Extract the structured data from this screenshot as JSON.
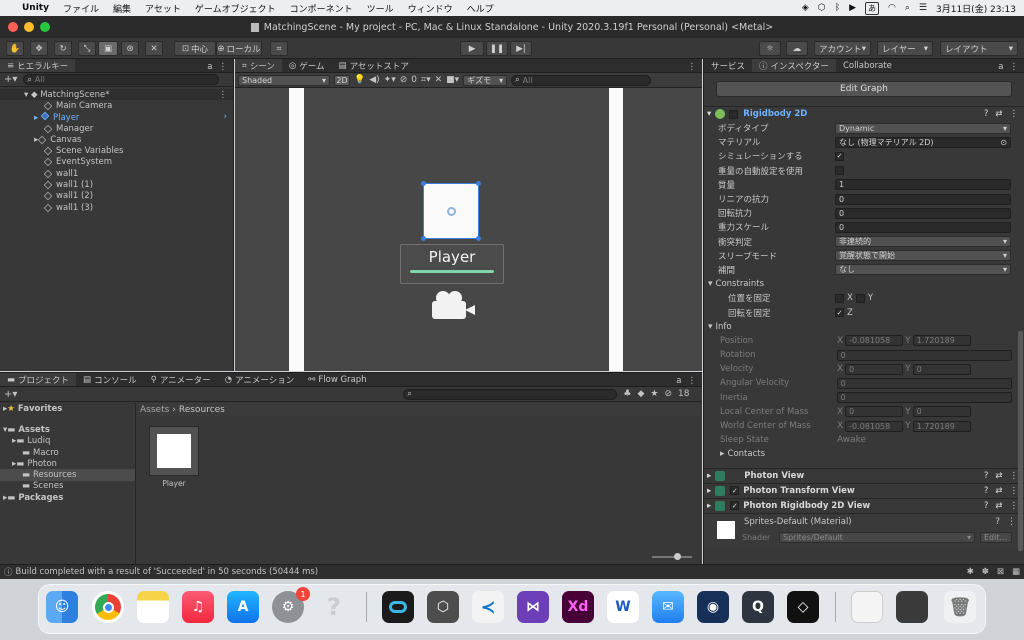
{
  "menubar": {
    "app": "Unity",
    "items": [
      "ファイル",
      "編集",
      "アセット",
      "ゲームオブジェクト",
      "コンポーネント",
      "ツール",
      "ウィンドウ",
      "ヘルプ"
    ],
    "clock": "3月11日(金)  23:13",
    "ime": "あ"
  },
  "window": {
    "title": "MatchingScene - My project - PC, Mac & Linux Standalone - Unity 2020.3.19f1 Personal (Personal) <Metal>"
  },
  "toolbar": {
    "pivot": "中心",
    "space": "ローカル",
    "account": "アカウント",
    "layers": "レイヤー",
    "layout": "レイアウト"
  },
  "hierarchy": {
    "tab": "ヒエラルキー",
    "search_placeholder": "All",
    "scene": "MatchingScene*",
    "items": [
      "Main Camera",
      "Player",
      "Manager",
      "Canvas",
      "Scene Variables",
      "EventSystem",
      "wall1",
      "wall1 (1)",
      "wall1 (2)",
      "wall1 (3)"
    ]
  },
  "scene_view": {
    "tabs": [
      "シーン",
      "ゲーム",
      "アセットストア"
    ],
    "shading": "Shaded",
    "mode2d": "2D",
    "gizmos": "ギズモ",
    "search_placeholder": "All",
    "hidden_count": "0",
    "object_label": "Player"
  },
  "project": {
    "tabs": [
      "プロジェクト",
      "コンソール",
      "アニメーター",
      "アニメーション",
      "Flow Graph"
    ],
    "favorites": "Favorites",
    "assets": "Assets",
    "folders": [
      "Ludiq",
      "Macro",
      "Photon",
      "Resources",
      "Scenes"
    ],
    "packages": "Packages",
    "breadcrumb_root": "Assets",
    "breadcrumb_current": "Resources",
    "asset_name": "Player",
    "count": "18"
  },
  "status": {
    "message": "Build completed with a result of 'Succeeded' in 50 seconds (50444 ms)"
  },
  "inspector": {
    "tabs": [
      "サービス",
      "インスペクター",
      "Collaborate"
    ],
    "edit_graph": "Edit Graph",
    "component_title": "Rigidbody 2D",
    "props": [
      {
        "label": "ボディタイプ",
        "value": "Dynamic"
      },
      {
        "label": "マテリアル",
        "value": "なし (物理マテリアル 2D)"
      },
      {
        "label": "シミュレーションする",
        "value": "✓"
      },
      {
        "label": "重量の自動設定を使用",
        "value": ""
      },
      {
        "label": "質量",
        "value": "1"
      },
      {
        "label": "リニアの抗力",
        "value": "0"
      },
      {
        "label": "回転抗力",
        "value": "0"
      },
      {
        "label": "重力スケール",
        "value": "0"
      },
      {
        "label": "衝突判定",
        "value": "非連続的"
      },
      {
        "label": "スリープモード",
        "value": "覚醒状態で開始"
      },
      {
        "label": "補間",
        "value": "なし"
      }
    ],
    "constraints": "Constraints",
    "freeze_pos": "位置を固定",
    "freeze_rot": "回転を固定",
    "x": "X",
    "y": "Y",
    "z": "Z",
    "info": "Info",
    "info_rows": [
      {
        "label": "Position",
        "x": "-0.081058",
        "y": "1.720189"
      },
      {
        "label": "Rotation",
        "v": "0"
      },
      {
        "label": "Velocity",
        "x": "0",
        "y": "0"
      },
      {
        "label": "Angular Velocity",
        "v": "0"
      },
      {
        "label": "Inertia",
        "v": "0"
      },
      {
        "label": "Local Center of Mass",
        "x": "0",
        "y": "0"
      },
      {
        "label": "World Center of Mass",
        "x": "-0.081058",
        "y": "1.720189"
      },
      {
        "label": "Sleep State",
        "v": "Awake"
      }
    ],
    "contacts": "Contacts",
    "components": [
      "Photon View",
      "Photon Transform View",
      "Photon Rigidbody 2D View"
    ],
    "material": "Sprites-Default (Material)",
    "shader_label": "Shader",
    "shader_value": "Sprites/Default",
    "shader_edit": "Edit..."
  },
  "dock": {
    "badge": "1",
    "apps": [
      "Finder",
      "Chrome",
      "Notes",
      "Music",
      "App Store",
      "System Preferences",
      "Help",
      "Webex",
      "Unity Hub",
      "VS Code",
      "Visual Studio",
      "Adobe XD",
      "Word",
      "Mail",
      "Steam",
      "QuickTime",
      "Unity",
      "Screenshot",
      "Screenshot 2",
      "Trash"
    ]
  },
  "colors": {
    "accent": "#3d7ddb",
    "unity_bg": "#383838",
    "scene_bg": "#474747"
  }
}
